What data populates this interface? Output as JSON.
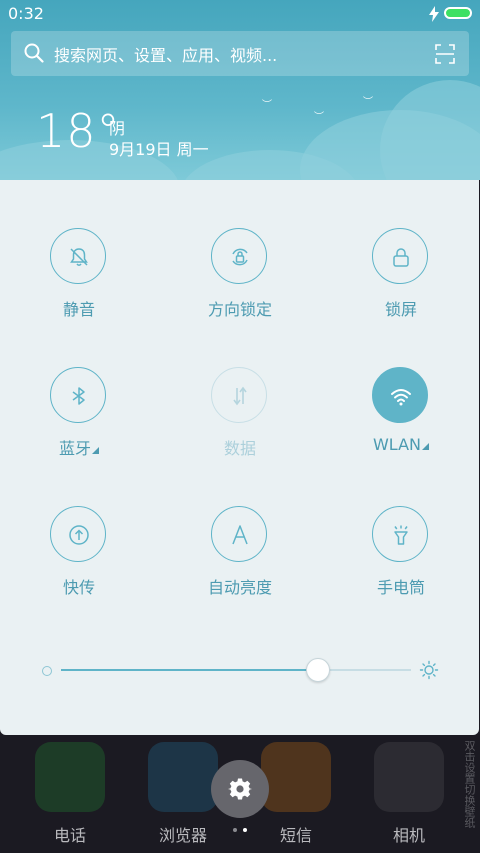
{
  "status_bar": {
    "time": "0:32"
  },
  "search": {
    "placeholder": "搜索网页、设置、应用、视频..."
  },
  "weather": {
    "temperature": "18°",
    "condition": "阴",
    "date": "9月19日 周一"
  },
  "quick_settings": {
    "tiles": [
      {
        "label": "静音",
        "icon": "bell-off-icon",
        "state": "off"
      },
      {
        "label": "方向锁定",
        "icon": "rotation-lock-icon",
        "state": "off"
      },
      {
        "label": "锁屏",
        "icon": "lock-icon",
        "state": "off"
      },
      {
        "label": "蓝牙",
        "icon": "bluetooth-icon",
        "state": "off",
        "has_more": true
      },
      {
        "label": "数据",
        "icon": "mobile-data-icon",
        "state": "disabled"
      },
      {
        "label": "WLAN",
        "icon": "wifi-icon",
        "state": "on",
        "has_more": true
      },
      {
        "label": "快传",
        "icon": "quick-transfer-icon",
        "state": "off"
      },
      {
        "label": "自动亮度",
        "icon": "auto-brightness-icon",
        "state": "off"
      },
      {
        "label": "手电筒",
        "icon": "flashlight-icon",
        "state": "off"
      }
    ],
    "brightness": {
      "level": 0.73
    }
  },
  "dock": {
    "apps": [
      {
        "label": "电话",
        "icon": "phone-icon"
      },
      {
        "label": "浏览器",
        "icon": "browser-icon"
      },
      {
        "label": "短信",
        "icon": "messages-icon"
      },
      {
        "label": "相机",
        "icon": "camera-icon"
      }
    ],
    "side_hint": "双击设置切换壁纸"
  },
  "colors": {
    "accent": "#5fb4c8",
    "label": "#4d9bb1",
    "panel": "#eaf1f3",
    "header": "#5fb7cb"
  }
}
